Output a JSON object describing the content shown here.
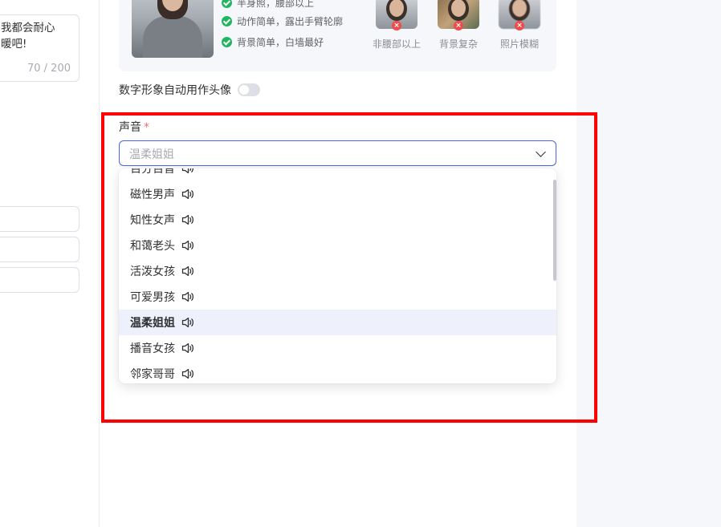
{
  "left_panel": {
    "textarea_text": "我都会耐心暖吧!",
    "textarea_line1": "我都会耐心",
    "textarea_line2": "暖吧!",
    "char_count": "70 / 200"
  },
  "guide": {
    "tips": [
      "半身照，腰部以上",
      "动作简单，露出手臂轮廓",
      "背景简单，白墙最好"
    ],
    "bad_examples": [
      "非腰部以上",
      "背景复杂",
      "照片模糊"
    ]
  },
  "avatar_switch": {
    "label": "数字形象自动用作头像",
    "enabled": false
  },
  "voice": {
    "label": "声音",
    "required_mark": "*",
    "selected": "温柔姐姐",
    "options": [
      "百分百音",
      "磁性男声",
      "知性女声",
      "和蔼老头",
      "活泼女孩",
      "可爱男孩",
      "温柔姐姐",
      "播音女孩",
      "邻家哥哥"
    ],
    "active_index": 6
  },
  "colors": {
    "accent": "#4b63e0",
    "highlight": "#ff0000",
    "success": "#22b55f",
    "error": "#f04b4b",
    "active_bg": "#eef0fc"
  }
}
